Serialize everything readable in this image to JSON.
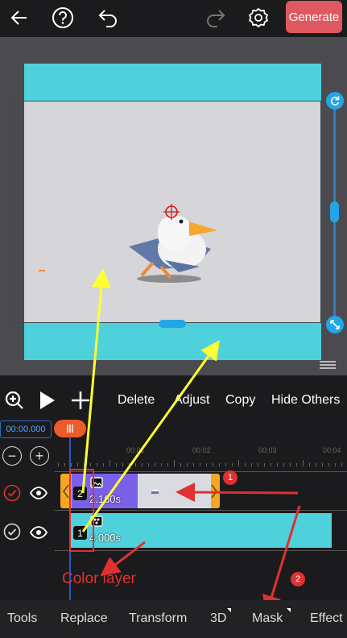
{
  "toolbar": {
    "back": "back-arrow-icon",
    "help": "help-icon",
    "undo": "undo-icon",
    "redo": "redo-icon",
    "settings": "gear-icon",
    "generate_label": "Generate"
  },
  "controls": {
    "delete": "Delete",
    "adjust": "Adjust",
    "copy": "Copy",
    "hide_others": "Hide Others"
  },
  "timeline": {
    "current_time": "00:00.000",
    "ticks": [
      "00:01",
      "00:02",
      "00:03",
      "00:04"
    ],
    "layers": [
      {
        "number": "2",
        "duration": "2.160s"
      },
      {
        "number": "1",
        "duration": "4.000s"
      }
    ]
  },
  "annotations": {
    "color_layer": "Color layer",
    "step1": "1",
    "step2": "2"
  },
  "tabs": [
    "Tools",
    "Replace",
    "Transform",
    "3D",
    "Mask",
    "Effect"
  ],
  "colors": {
    "accent_blue": "#22a6e8",
    "generate": "#e0585f",
    "cyan_layer": "#4fd1dc",
    "annotation_red": "#e03030",
    "annotation_yellow": "#ffff33"
  }
}
